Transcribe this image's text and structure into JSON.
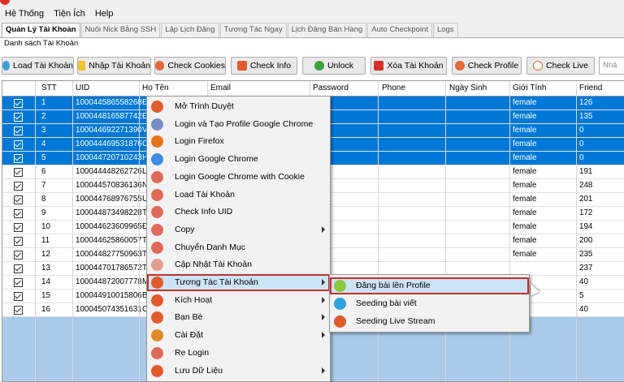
{
  "colors": {
    "selection": "#0078d7",
    "highlight_outline": "#c4312b",
    "menu_bg": "#f2f2f2",
    "grid_bg": "#abc9e8"
  },
  "menubar": [
    "Hệ Thống",
    "Tiện Ích",
    "Help"
  ],
  "tabs": [
    {
      "label": "Quản Lý Tài Khoản",
      "active": true
    },
    {
      "label": "Nuôi Nick Bằng SSH"
    },
    {
      "label": "Lập Lịch Đăng"
    },
    {
      "label": "Tương Tác Ngay"
    },
    {
      "label": "Lịch Đăng Bán Hàng"
    },
    {
      "label": "Auto Checkpoint"
    },
    {
      "label": "Logs"
    }
  ],
  "group_title": "Danh sách Tài Khoản",
  "toolbar": {
    "load": "Load Tài Khoản",
    "import": "Nhập Tài Khoản",
    "check_cookies": "Check Cookies",
    "check_info": "Check Info",
    "unlock": "Unlock",
    "delete": "Xóa Tài Khoản",
    "check_profile": "Check Profile",
    "check_live": "Check Live",
    "search_placeholder": "Nhậ"
  },
  "columns": [
    "STT",
    "UID",
    "Họ Tên",
    "Email",
    "Password",
    "Phone",
    "Ngày Sinh",
    "Giới Tính",
    "Friend"
  ],
  "rows": [
    {
      "stt": "1",
      "uid": "100044586558268",
      "name": "Đ",
      "gender": "female",
      "friend": "126",
      "sel": true
    },
    {
      "stt": "2",
      "uid": "100044816587742",
      "name": "Đ",
      "gender": "female",
      "friend": "135",
      "sel": true
    },
    {
      "stt": "3",
      "uid": "100044692271390",
      "name": "Vi",
      "gender": "female",
      "friend": "0",
      "sel": true
    },
    {
      "stt": "4",
      "uid": "100044469531876",
      "name": "Co",
      "gender": "female",
      "friend": "0",
      "sel": true
    },
    {
      "stt": "5",
      "uid": "100044720710243",
      "name": "Hu",
      "gender": "female",
      "friend": "0",
      "sel": true
    },
    {
      "stt": "6",
      "uid": "100044448262726",
      "name": "Lê",
      "gender": "female",
      "friend": "191",
      "sel": false
    },
    {
      "stt": "7",
      "uid": "100044570836136",
      "name": "Nô",
      "gender": "female",
      "friend": "248",
      "sel": false
    },
    {
      "stt": "8",
      "uid": "100044768976755",
      "name": "Uy",
      "gender": "female",
      "friend": "201",
      "sel": false
    },
    {
      "stt": "9",
      "uid": "100044873498228",
      "name": "Ta",
      "gender": "female",
      "friend": "172",
      "sel": false
    },
    {
      "stt": "10",
      "uid": "100044623609965",
      "name": "Đa",
      "gender": "female",
      "friend": "194",
      "sel": false
    },
    {
      "stt": "11",
      "uid": "100044625860057",
      "name": "Tú",
      "gender": "female",
      "friend": "200",
      "sel": false
    },
    {
      "stt": "12",
      "uid": "100044827750963",
      "name": "Th",
      "gender": "female",
      "friend": "235",
      "sel": false
    },
    {
      "stt": "13",
      "uid": "100044701786572",
      "name": "Tu",
      "gender": "",
      "friend": "237",
      "sel": false
    },
    {
      "stt": "14",
      "uid": "100044872007778",
      "name": "Mi",
      "gender": "",
      "friend": "40",
      "sel": false
    },
    {
      "stt": "15",
      "uid": "100044910015806",
      "name": "Bả",
      "gender": "",
      "friend": "5",
      "sel": false
    },
    {
      "stt": "16",
      "uid": "100045074351631",
      "name": "Ch",
      "gender": "",
      "friend": "40",
      "sel": false
    }
  ],
  "context_menu": [
    {
      "label": "Mở Trình Duyệt",
      "icon": "globe-icon",
      "color": "#e05a2b"
    },
    {
      "label": "Login và Tạo Profile Google Chrome",
      "icon": "chrome-add-icon",
      "color": "#7a8cc6"
    },
    {
      "label": "Login Firefox",
      "icon": "firefox-icon",
      "color": "#e8741a"
    },
    {
      "label": "Login Google Chrome",
      "icon": "chrome-icon",
      "color": "#3b8de0"
    },
    {
      "label": "Login Google Chrome with Cookie",
      "icon": "chrome-cookie-icon",
      "color": "#e06a5a"
    },
    {
      "label": "Load Tài Khoản",
      "icon": "reload-icon",
      "color": "#e06a5a"
    },
    {
      "label": "Check Info UID",
      "icon": "document-icon",
      "color": "#e06a5a"
    },
    {
      "label": "Copy",
      "icon": "copy-icon",
      "color": "#e06a5a",
      "sub": true
    },
    {
      "label": "Chuyển Danh Mục",
      "icon": "move-icon",
      "color": "#e06a5a"
    },
    {
      "label": "Cập Nhật Tài Khoản",
      "icon": "update-icon",
      "color": "#e0a090"
    },
    {
      "label": "Tương Tác Tài Khoản",
      "icon": "users-icon",
      "color": "#e05a2b",
      "sub": true,
      "hl": true
    },
    {
      "label": "Kích Hoạt",
      "icon": "check-circle-icon",
      "color": "#e05a2b",
      "sub": true
    },
    {
      "label": "Bạn Bè",
      "icon": "friends-icon",
      "color": "#e05a2b",
      "sub": true
    },
    {
      "label": "Cài Đặt",
      "icon": "gear-icon",
      "color": "#e08a2b",
      "sub": true
    },
    {
      "label": "Re Login",
      "icon": "relogin-icon",
      "color": "#e06a5a"
    },
    {
      "label": "Lưu Dữ Liệu",
      "icon": "save-icon",
      "color": "#e05a2b",
      "sub": true
    }
  ],
  "submenu": [
    {
      "label": "Đăng bài lên Profile",
      "icon": "play-icon",
      "color": "#8cc63f",
      "hl": true
    },
    {
      "label": "Seeding bài viết",
      "icon": "refresh-icon",
      "color": "#2ea3d9"
    },
    {
      "label": "Seeding Live Stream",
      "icon": "thumbs-up-icon",
      "color": "#e05a2b"
    }
  ]
}
